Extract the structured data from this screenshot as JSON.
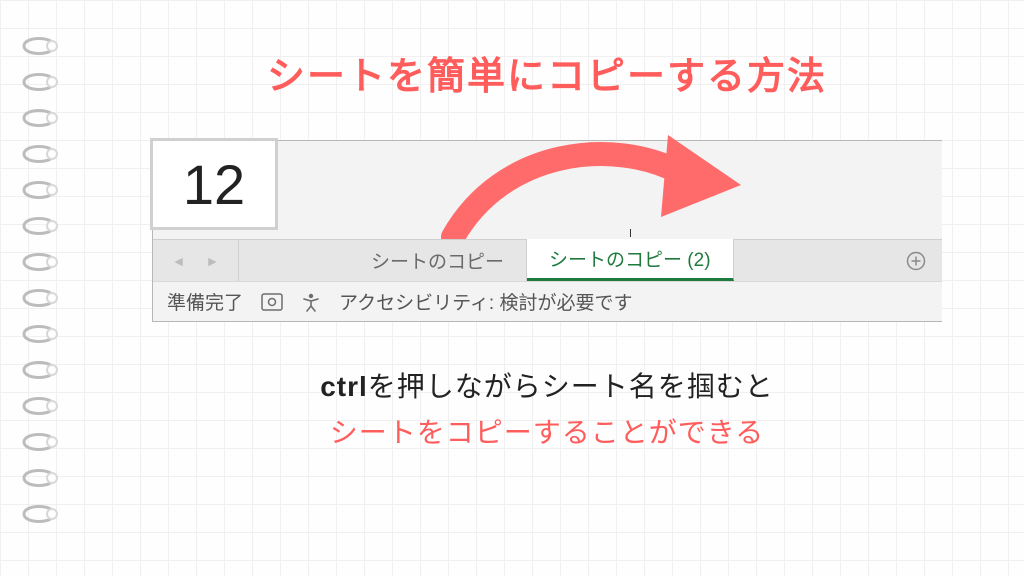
{
  "title": "シートを簡単にコピーする方法",
  "excel": {
    "cell_value": "12",
    "tabs": {
      "inactive": "シートのコピー",
      "active": "シートのコピー (2)"
    },
    "status": {
      "ready": "準備完了",
      "accessibility": "アクセシビリティ: 検討が必要です"
    }
  },
  "caption": {
    "kbd": "ctrl",
    "line1_rest": "を押しながらシート名を掴むと",
    "line2": "シートをコピーすることができる"
  },
  "colors": {
    "accent": "#ff5c5c",
    "excel_green": "#1f7a3e"
  }
}
